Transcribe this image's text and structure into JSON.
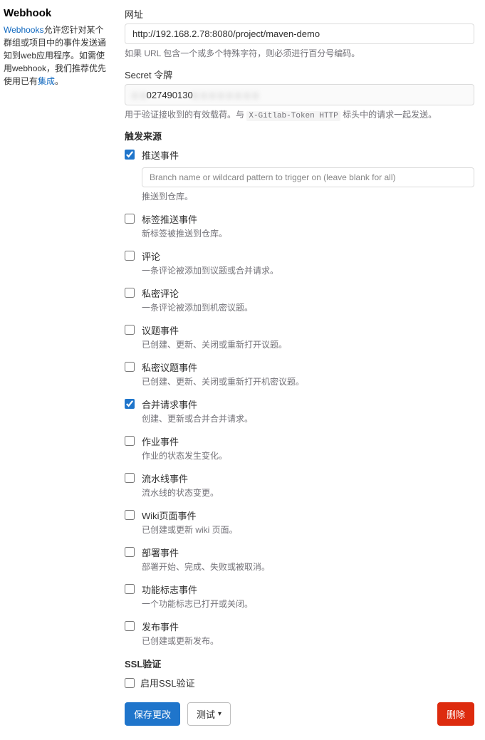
{
  "sidebar": {
    "title": "Webhook",
    "link_text_1": "Webhooks",
    "desc_part_1": "允许您针对某个群组或项目中的事件发送通知到web应用程序。如需使用webhook，我们推荐优先使用已有",
    "link_text_2": "集成",
    "desc_part_2": "。"
  },
  "url": {
    "label": "网址",
    "value": "http://192.168.2.78:8080/project/maven-demo",
    "help": "如果 URL 包含一个或多个特殊字符，则必须进行百分号编码。"
  },
  "secret": {
    "label": "Secret 令牌",
    "masked_preview_prefix": "027490130",
    "help_before": "用于验证接收到的有效载荷。与 ",
    "help_code": "X-Gitlab-Token HTTP",
    "help_after": " 标头中的请求一起发送。"
  },
  "triggers": {
    "section_label": "触发来源",
    "items": [
      {
        "checked": true,
        "title": "推送事件",
        "desc": "推送到仓库。",
        "has_branch_input": true,
        "branch_placeholder": "Branch name or wildcard pattern to trigger on (leave blank for all)"
      },
      {
        "checked": false,
        "title": "标签推送事件",
        "desc": "新标签被推送到仓库。"
      },
      {
        "checked": false,
        "title": "评论",
        "desc": "一条评论被添加到议题或合并请求。"
      },
      {
        "checked": false,
        "title": "私密评论",
        "desc": "一条评论被添加到机密议题。"
      },
      {
        "checked": false,
        "title": "议题事件",
        "desc": "已创建、更新、关闭或重新打开议题。"
      },
      {
        "checked": false,
        "title": "私密议题事件",
        "desc": "已创建、更新、关闭或重新打开机密议题。"
      },
      {
        "checked": true,
        "title": "合并请求事件",
        "desc": "创建、更新或合并合并请求。"
      },
      {
        "checked": false,
        "title": "作业事件",
        "desc": "作业的状态发生变化。"
      },
      {
        "checked": false,
        "title": "流水线事件",
        "desc": "流水线的状态变更。"
      },
      {
        "checked": false,
        "title": "Wiki页面事件",
        "desc": "已创建或更新 wiki 页面。"
      },
      {
        "checked": false,
        "title": "部署事件",
        "desc": "部署开始、完成、失败或被取消。"
      },
      {
        "checked": false,
        "title": "功能标志事件",
        "desc": "一个功能标志已打开或关闭。"
      },
      {
        "checked": false,
        "title": "发布事件",
        "desc": "已创建或更新发布。"
      }
    ]
  },
  "ssl": {
    "section_label": "SSL验证",
    "checkbox_label": "启用SSL验证",
    "checked": false
  },
  "actions": {
    "save_label": "保存更改",
    "test_label": "测试",
    "delete_label": "删除"
  }
}
